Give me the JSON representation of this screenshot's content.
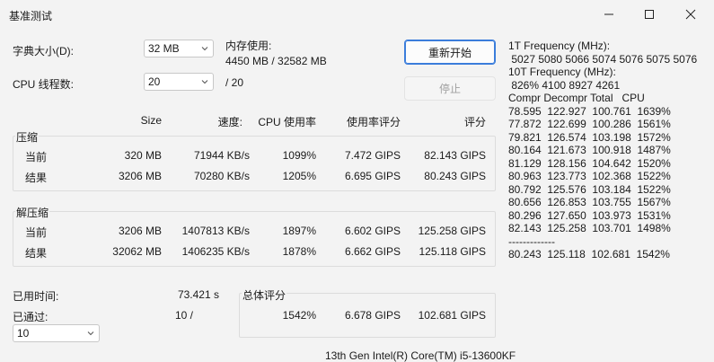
{
  "window": {
    "title": "基准测试"
  },
  "settings": {
    "dict_label": "字典大小(D):",
    "dict_value": "32 MB",
    "threads_label": "CPU 线程数:",
    "threads_value": "20",
    "threads_total": "/ 20",
    "memory_label": "内存使用:",
    "memory_value": "4450 MB / 32582 MB"
  },
  "buttons": {
    "restart": "重新开始",
    "stop": "停止"
  },
  "table": {
    "headers": {
      "size": "Size",
      "speed": "速度:",
      "cpu": "CPU 使用率",
      "rating_per_usage": "使用率评分",
      "rating": "评分"
    },
    "compress": {
      "title": "压缩",
      "rows": [
        {
          "label": "当前",
          "size": "320 MB",
          "speed": "71944 KB/s",
          "cpu": "1099%",
          "rpu": "7.472 GIPS",
          "rating": "82.143 GIPS"
        },
        {
          "label": "结果",
          "size": "3206 MB",
          "speed": "70280 KB/s",
          "cpu": "1205%",
          "rpu": "6.695 GIPS",
          "rating": "80.243 GIPS"
        }
      ]
    },
    "decompress": {
      "title": "解压缩",
      "rows": [
        {
          "label": "当前",
          "size": "3206 MB",
          "speed": "1407813 KB/s",
          "cpu": "1897%",
          "rpu": "6.602 GIPS",
          "rating": "125.258 GIPS"
        },
        {
          "label": "结果",
          "size": "32062 MB",
          "speed": "1406235 KB/s",
          "cpu": "1878%",
          "rpu": "6.662 GIPS",
          "rating": "125.118 GIPS"
        }
      ]
    }
  },
  "status": {
    "elapsed_label": "已用时间:",
    "elapsed_value": "73.421 s",
    "passed_label": "已通过:",
    "passed_value": "10 /",
    "passes_select": "10"
  },
  "total": {
    "title": "总体评分",
    "cpu": "1542%",
    "rpu": "6.678 GIPS",
    "rating": "102.681 GIPS"
  },
  "cpu_name": "13th Gen Intel(R) Core(TM) i5-13600KF",
  "log_lines": [
    "1T Frequency (MHz):",
    " 5027 5080 5066 5074 5076 5075 5076",
    "10T Frequency (MHz):",
    " 826% 4100 8927 4261",
    "Compr Decompr Total   CPU",
    "78.595  122.927  100.761  1639%",
    "77.872  122.699  100.286  1561%",
    "79.821  126.574  103.198  1572%",
    "80.164  121.673  100.918  1487%",
    "81.129  128.156  104.642  1520%",
    "80.963  123.773  102.368  1522%",
    "80.792  125.576  103.184  1522%",
    "80.656  126.853  103.755  1567%",
    "80.296  127.650  103.973  1531%",
    "82.143  125.258  103.701  1498%",
    "-------------",
    "80.243  125.118  102.681  1542%"
  ]
}
